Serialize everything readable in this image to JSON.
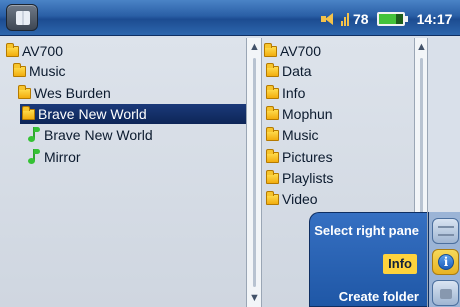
{
  "status": {
    "volume": "78",
    "time": "14:17"
  },
  "left_pane": {
    "items": [
      {
        "label": "AV700",
        "type": "folder"
      },
      {
        "label": "Music",
        "type": "folder"
      },
      {
        "label": "Wes Burden",
        "type": "folder"
      },
      {
        "label": "Brave New World",
        "type": "folder",
        "selected": true
      },
      {
        "label": "Brave New World",
        "type": "music-file"
      },
      {
        "label": "Mirror",
        "type": "music-file"
      }
    ]
  },
  "right_pane": {
    "items": [
      {
        "label": "AV700",
        "type": "folder"
      },
      {
        "label": "Data",
        "type": "folder"
      },
      {
        "label": "Info",
        "type": "folder"
      },
      {
        "label": "Mophun",
        "type": "folder"
      },
      {
        "label": "Music",
        "type": "folder"
      },
      {
        "label": "Pictures",
        "type": "folder"
      },
      {
        "label": "Playlists",
        "type": "folder"
      },
      {
        "label": "Video",
        "type": "folder"
      }
    ]
  },
  "menu": {
    "select_right_pane": "Select right pane",
    "info": "Info",
    "create_folder": "Create folder"
  },
  "icons": {
    "home": "home-book-icon",
    "volume": "speaker-icon",
    "battery": "battery-icon",
    "folder": "folder-icon",
    "music_file": "music-note-icon",
    "scroll_up": "scroll-up-arrow-icon",
    "scroll_down": "scroll-down-arrow-icon",
    "side_1": "swap-pane-icon",
    "side_2": "info-icon",
    "side_3": "lock-icon"
  },
  "colors": {
    "accent": "#2a5fa6",
    "selection": "#0d2557",
    "highlight": "#ffd33c"
  }
}
